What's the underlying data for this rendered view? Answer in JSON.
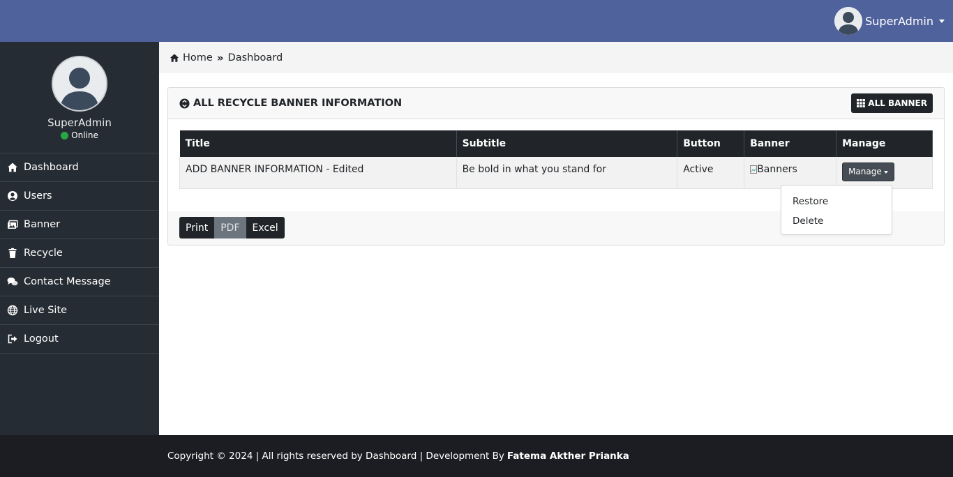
{
  "topbar": {
    "user_name": "SuperAdmin"
  },
  "sidebar": {
    "profile_name": "SuperAdmin",
    "status": "Online",
    "items": [
      {
        "label": "Dashboard",
        "icon": "home-icon"
      },
      {
        "label": "Users",
        "icon": "user-circle-icon"
      },
      {
        "label": "Banner",
        "icon": "images-icon"
      },
      {
        "label": "Recycle",
        "icon": "trash-icon"
      },
      {
        "label": "Contact Message",
        "icon": "comments-icon"
      },
      {
        "label": "Live Site",
        "icon": "globe-icon"
      },
      {
        "label": "Logout",
        "icon": "sign-out-icon"
      }
    ]
  },
  "breadcrumb": {
    "home": "Home",
    "current": "Dashboard"
  },
  "card": {
    "title": "ALL RECYCLE BANNER INFORMATION",
    "all_banner_label": "ALL BANNER",
    "columns": [
      "Title",
      "Subtitle",
      "Button",
      "Banner",
      "Manage"
    ],
    "rows": [
      {
        "title": "ADD BANNER INFORMATION - Edited",
        "subtitle": "Be bold in what you stand for",
        "button": "Active",
        "banner_alt": "Banners",
        "manage_label": "Manage"
      }
    ],
    "export_buttons": [
      "Print",
      "PDF",
      "Excel"
    ]
  },
  "dropdown": {
    "items": [
      "Restore",
      "Delete"
    ]
  },
  "footer": {
    "text": "Copyright © 2024 | All rights reserved by Dashboard | Development By",
    "author": "Fatema Akther Prianka"
  },
  "colors": {
    "topbar": "#4f629b",
    "sidebar": "#262c33",
    "online": "#28a745",
    "dark": "#212529"
  }
}
